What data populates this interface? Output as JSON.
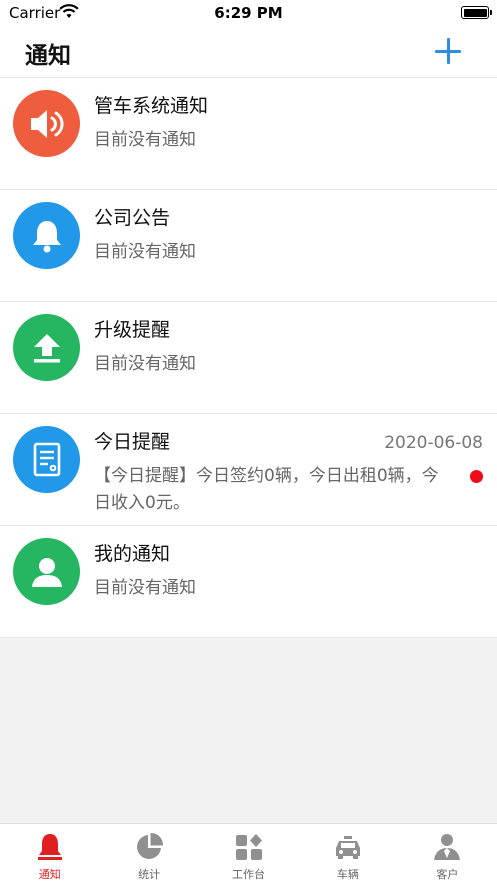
{
  "status_bar": {
    "carrier": "Carrier",
    "time": "6:29 PM"
  },
  "header": {
    "title": "通知",
    "add_icon": "plus-icon"
  },
  "notifications": [
    {
      "title": "管车系统通知",
      "subtitle": "目前没有通知",
      "icon": "speaker-icon",
      "color": "#ee5d3e"
    },
    {
      "title": "公司公告",
      "subtitle": "目前没有通知",
      "icon": "bell-icon",
      "color": "#2199e8"
    },
    {
      "title": "升级提醒",
      "subtitle": "目前没有通知",
      "icon": "upload-icon",
      "color": "#26b561"
    },
    {
      "title": "今日提醒",
      "subtitle": "【今日提醒】今日签约0辆，今日出租0辆，今日收入0元。",
      "date": "2020-06-08",
      "unread": true,
      "icon": "document-icon",
      "color": "#2199e8"
    },
    {
      "title": "我的通知",
      "subtitle": "目前没有通知",
      "icon": "user-icon",
      "color": "#26b561"
    }
  ],
  "tabbar": {
    "active_color": "#e02020",
    "items": [
      {
        "label": "通知",
        "icon": "bell-icon",
        "active": true
      },
      {
        "label": "统计",
        "icon": "pie-chart-icon"
      },
      {
        "label": "工作台",
        "icon": "grid-icon"
      },
      {
        "label": "车辆",
        "icon": "car-icon"
      },
      {
        "label": "客户",
        "icon": "customer-icon"
      }
    ]
  }
}
